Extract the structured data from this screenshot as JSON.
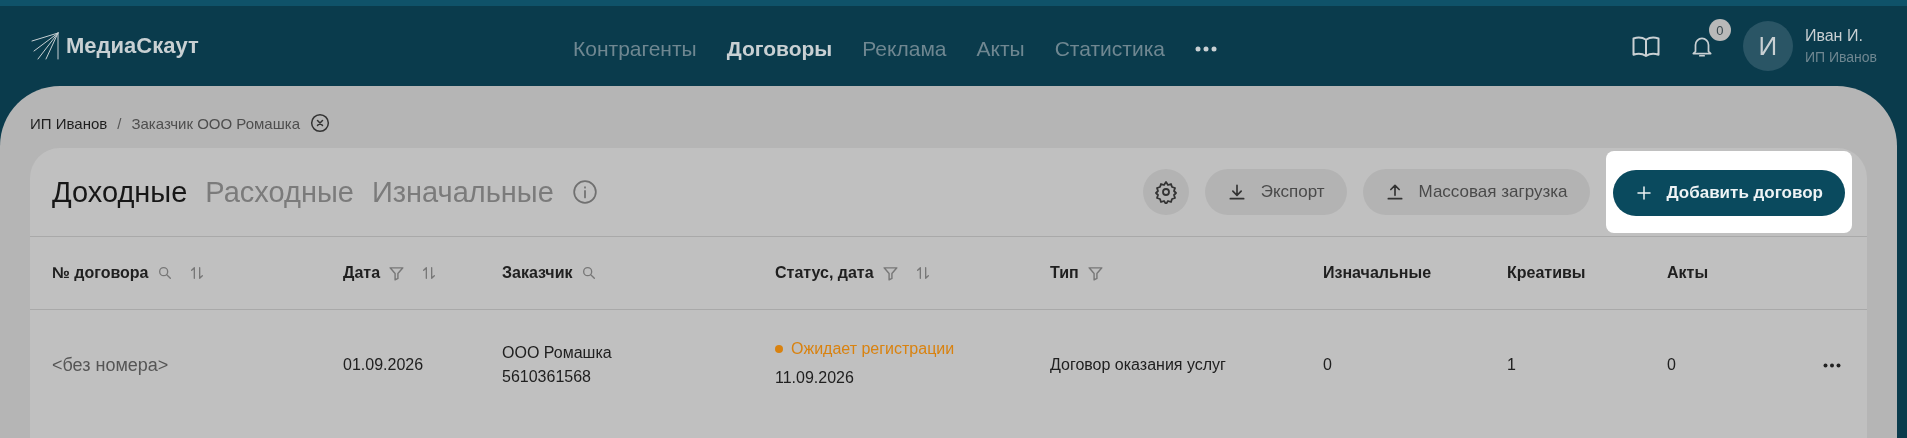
{
  "header": {
    "logo": "МедиаСкаут",
    "nav": [
      {
        "label": "Контрагенты",
        "selected": false
      },
      {
        "label": "Договоры",
        "selected": true
      },
      {
        "label": "Реклама",
        "selected": false
      },
      {
        "label": "Акты",
        "selected": false
      },
      {
        "label": "Статистика",
        "selected": false
      }
    ],
    "notifications_count": "0",
    "user": {
      "initial": "И",
      "name": "Иван И.",
      "company": "ИП Иванов"
    }
  },
  "breadcrumbs": [
    "ИП Иванов",
    "Заказчик ООО Ромашка"
  ],
  "breadcrumb_separator": "/",
  "tabs": [
    {
      "label": "Доходные",
      "selected": true
    },
    {
      "label": "Расходные",
      "selected": false
    },
    {
      "label": "Изначальные",
      "selected": false
    }
  ],
  "toolbar": {
    "buttons": [
      {
        "label": "Экспорт",
        "kind": "download"
      },
      {
        "label": "Массовая загрузка",
        "kind": "upload"
      }
    ],
    "primary": {
      "label": "Добавить договор",
      "highlighted": true
    }
  },
  "table": {
    "columns": [
      {
        "label": "№ договора",
        "search": true,
        "filter": false,
        "sortable": true
      },
      {
        "label": "Дата",
        "search": false,
        "filter": true,
        "sortable": true
      },
      {
        "label": "Заказчик",
        "search": true,
        "filter": false,
        "sortable": false
      },
      {
        "label": "Статус, дата",
        "search": false,
        "filter": true,
        "sortable": true
      },
      {
        "label": "Тип",
        "search": false,
        "filter": true,
        "sortable": false
      },
      {
        "label": "Изначальные",
        "search": false,
        "filter": false,
        "sortable": false
      },
      {
        "label": "Креативы",
        "search": false,
        "filter": false,
        "sortable": false
      },
      {
        "label": "Акты",
        "search": false,
        "filter": false,
        "sortable": false
      }
    ],
    "rows": [
      {
        "number": "<без номера>",
        "date": "01.09.2026",
        "customer_name": "ООО Ромашка",
        "customer_inn": "5610361568",
        "status": {
          "label": "Ожидает регистрации",
          "color": "#d9820f"
        },
        "status_date": "11.09.2026",
        "type": "Договор оказания услуг",
        "initial": "0",
        "creatives": "1",
        "acts": "0"
      }
    ]
  }
}
